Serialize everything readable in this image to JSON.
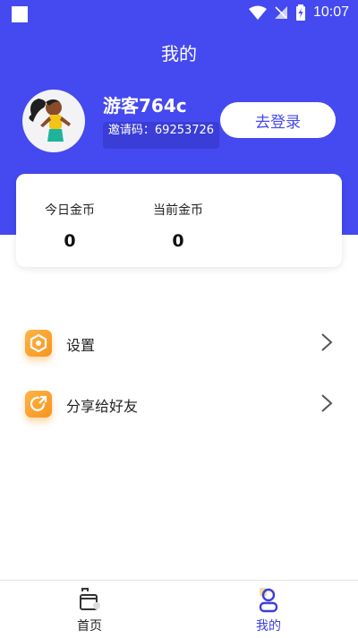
{
  "status_bar": {
    "time": "10:07"
  },
  "header": {
    "title": "我的"
  },
  "profile": {
    "username": "游客764c",
    "invite_code": "邀请码：69253726",
    "login_button": "去登录"
  },
  "stats": [
    {
      "label": "今日金币",
      "value": "0"
    },
    {
      "label": "当前金币",
      "value": "0"
    }
  ],
  "menu": [
    {
      "label": "设置",
      "icon": "hexagon-settings-icon"
    },
    {
      "label": "分享给好友",
      "icon": "share-icon"
    }
  ],
  "bottom_nav": [
    {
      "label": "首页",
      "icon": "home-icon",
      "active": false
    },
    {
      "label": "我的",
      "icon": "user-icon",
      "active": true
    }
  ],
  "colors": {
    "primary": "#4549F0",
    "accent": "#F7941D",
    "text": "#222222"
  }
}
